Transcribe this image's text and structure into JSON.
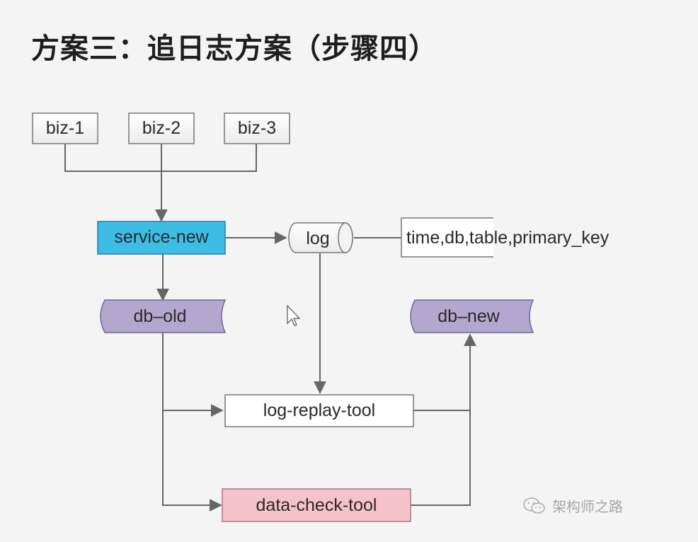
{
  "title": "方案三：追日志方案（步骤四）",
  "nodes": {
    "biz1": "biz-1",
    "biz2": "biz-2",
    "biz3": "biz-3",
    "service_new": "service-new",
    "log": "log",
    "log_fields": "time,db,table,primary_key",
    "db_old": "db–old",
    "db_new": "db–new",
    "log_replay_tool": "log-replay-tool",
    "data_check_tool": "data-check-tool"
  },
  "watermark": "架构师之路",
  "colors": {
    "service_new": "#3dbde6",
    "database": "#b3a7cf",
    "data_check_tool": "#f6c2cc",
    "edge": "#666666"
  }
}
